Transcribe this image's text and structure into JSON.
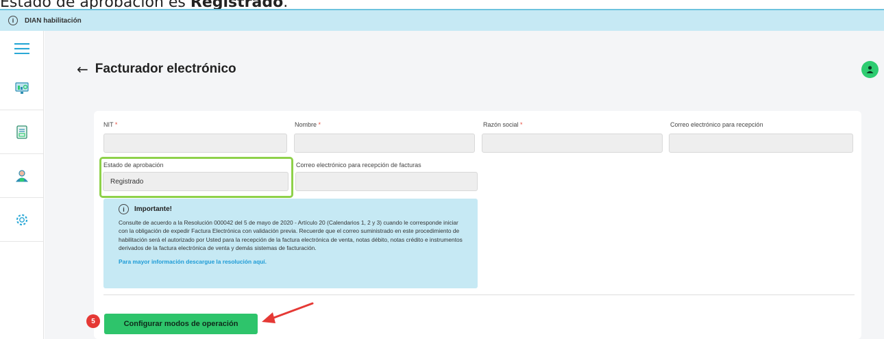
{
  "caption": {
    "prefix": "Estado de aprobación es ",
    "bold": "Registrado",
    "suffix": "."
  },
  "topbar": {
    "title": "DIAN habilitación",
    "info_icon": "i"
  },
  "sidebar": {
    "items": [
      {
        "icon": "menu-icon"
      },
      {
        "icon": "dashboard-icon"
      },
      {
        "icon": "document-icon"
      },
      {
        "icon": "user-settings-icon"
      },
      {
        "icon": "gear-icon"
      }
    ]
  },
  "header": {
    "back": "←",
    "title": "Facturador electrónico"
  },
  "form": {
    "nit_label": "NIT",
    "nombre_label": "Nombre",
    "razon_label": "Razón social",
    "correo_label": "Correo electrónico para recepción",
    "required_mark": "*",
    "estado_label": "Estado de aprobación",
    "estado_value": "Registrado",
    "correo_facturas_label": "Correo electrónico para recepción de facturas"
  },
  "notice": {
    "icon": "i",
    "title": "Importante!",
    "body": "Consulte de acuerdo a la Resolución 000042 del 5 de mayo de 2020 - Artículo 20 (Calendarios 1, 2 y 3) cuando le corresponde iniciar con la obligación de expedir Factura Electrónica con validación previa. Recuerde que el correo suministrado en este procedimiento de habilitación será el autorizado por Usted para la recepción de la factura electrónica de venta, notas débito, notas crédito e instrumentos derivados de la factura electrónica de venta y demás sistemas de facturación.",
    "link": "Para mayor información descargue la resolución aquí."
  },
  "step_badge": "5",
  "config_button": "Configurar modos de operación",
  "colors": {
    "accent_green": "#2ec46b",
    "highlight_green": "#8ed14a",
    "info_blue": "#c6e9f4",
    "link_blue": "#1d9bd6",
    "badge_red": "#e53935"
  }
}
